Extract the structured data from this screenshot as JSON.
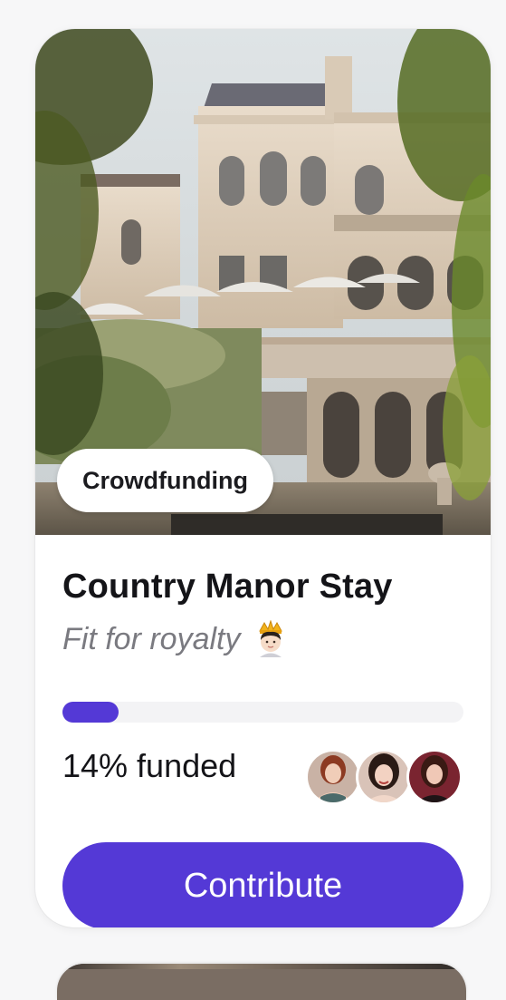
{
  "card": {
    "tag_label": "Crowdfunding",
    "title": "Country Manor Stay",
    "subtitle": "Fit for royalty",
    "subtitle_emoji": "crown-person-emoji",
    "progress": {
      "fraction": 0.14
    },
    "funded_text": "14% funded",
    "contributors": [
      {
        "name": "contributor-avatar-1"
      },
      {
        "name": "contributor-avatar-2"
      },
      {
        "name": "contributor-avatar-3"
      }
    ],
    "cta_label": "Contribute"
  },
  "colors": {
    "accent": "#5439d6",
    "track": "#f3f3f5",
    "title": "#141418",
    "subtitle": "#7a7a80"
  }
}
